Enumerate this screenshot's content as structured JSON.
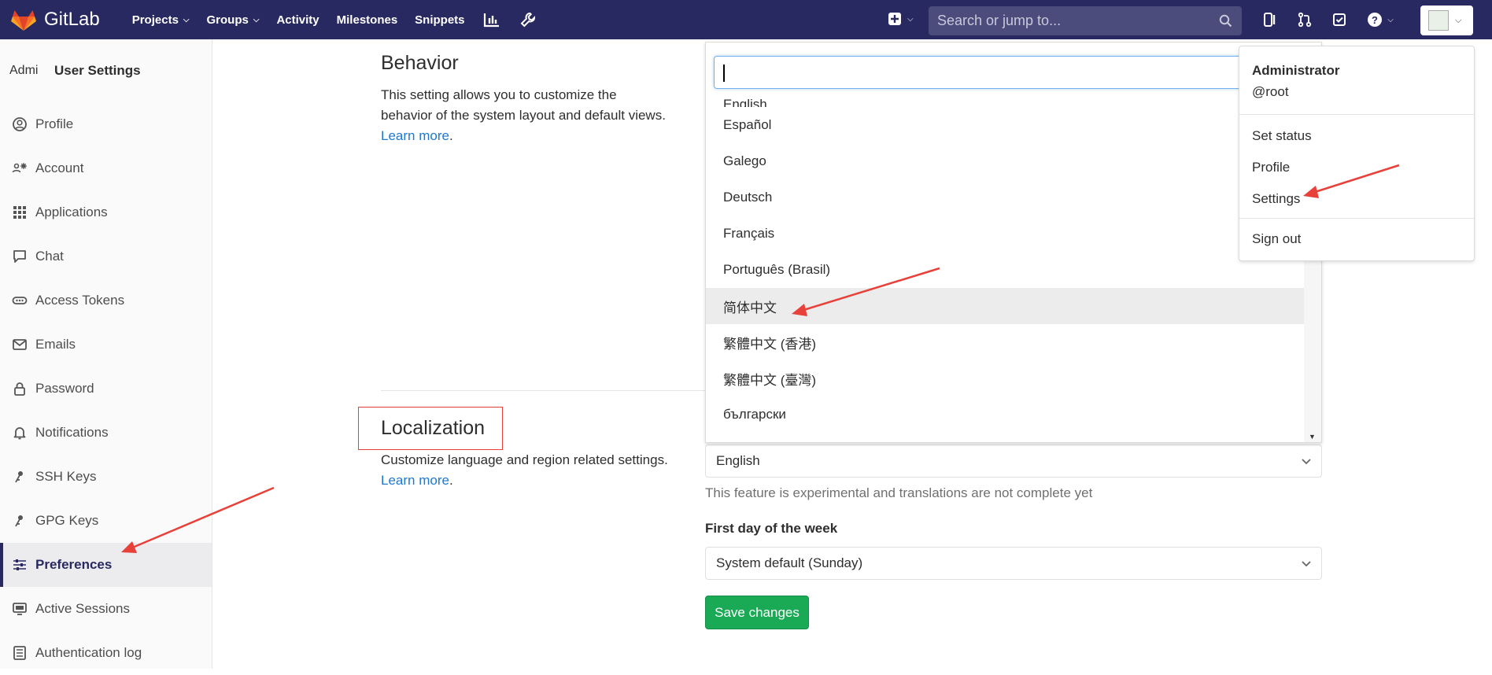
{
  "navbar": {
    "brand": "GitLab",
    "menu": [
      {
        "label": "Projects",
        "caret": true
      },
      {
        "label": "Groups",
        "caret": true
      },
      {
        "label": "Activity",
        "caret": false
      },
      {
        "label": "Milestones",
        "caret": false
      },
      {
        "label": "Snippets",
        "caret": false
      }
    ],
    "search_placeholder": "Search or jump to...",
    "colors": {
      "bg": "#292961",
      "search_bg": "#4b4b7c"
    }
  },
  "sidebar": {
    "avatar_alt": "Admi",
    "title": "User Settings",
    "items": [
      {
        "label": "Profile",
        "icon": "profile-icon"
      },
      {
        "label": "Account",
        "icon": "account-icon"
      },
      {
        "label": "Applications",
        "icon": "applications-icon"
      },
      {
        "label": "Chat",
        "icon": "chat-icon"
      },
      {
        "label": "Access Tokens",
        "icon": "token-icon"
      },
      {
        "label": "Emails",
        "icon": "mail-icon"
      },
      {
        "label": "Password",
        "icon": "lock-icon"
      },
      {
        "label": "Notifications",
        "icon": "bell-icon"
      },
      {
        "label": "SSH Keys",
        "icon": "key-icon"
      },
      {
        "label": "GPG Keys",
        "icon": "key-icon"
      },
      {
        "label": "Preferences",
        "icon": "preferences-icon",
        "active": true
      },
      {
        "label": "Active Sessions",
        "icon": "monitor-icon"
      },
      {
        "label": "Authentication log",
        "icon": "log-icon"
      }
    ]
  },
  "behavior": {
    "title": "Behavior",
    "desc_line1": "This setting allows you to customize the",
    "desc_line2": "behavior of the system layout and default views.",
    "learn_more": "Learn more",
    "period": "."
  },
  "localization": {
    "title": "Localization",
    "desc": "Customize language and region related settings.",
    "learn_more": "Learn more",
    "period": ".",
    "language_value": "English",
    "language_help": "This feature is experimental and translations are not complete yet",
    "first_day_label": "First day of the week",
    "first_day_value": "System default (Sunday)",
    "save_label": "Save changes"
  },
  "language_dropdown": {
    "search_value": "",
    "options": [
      "English",
      "Español",
      "Galego",
      "Deutsch",
      "Français",
      "Português (Brasil)",
      "简体中文",
      "繁體中文 (香港)",
      "繁體中文 (臺灣)",
      "български"
    ],
    "highlighted": "简体中文"
  },
  "user_dropdown": {
    "name": "Administrator",
    "handle": "@root",
    "items": [
      "Set status",
      "Profile",
      "Settings",
      "Sign out"
    ]
  }
}
